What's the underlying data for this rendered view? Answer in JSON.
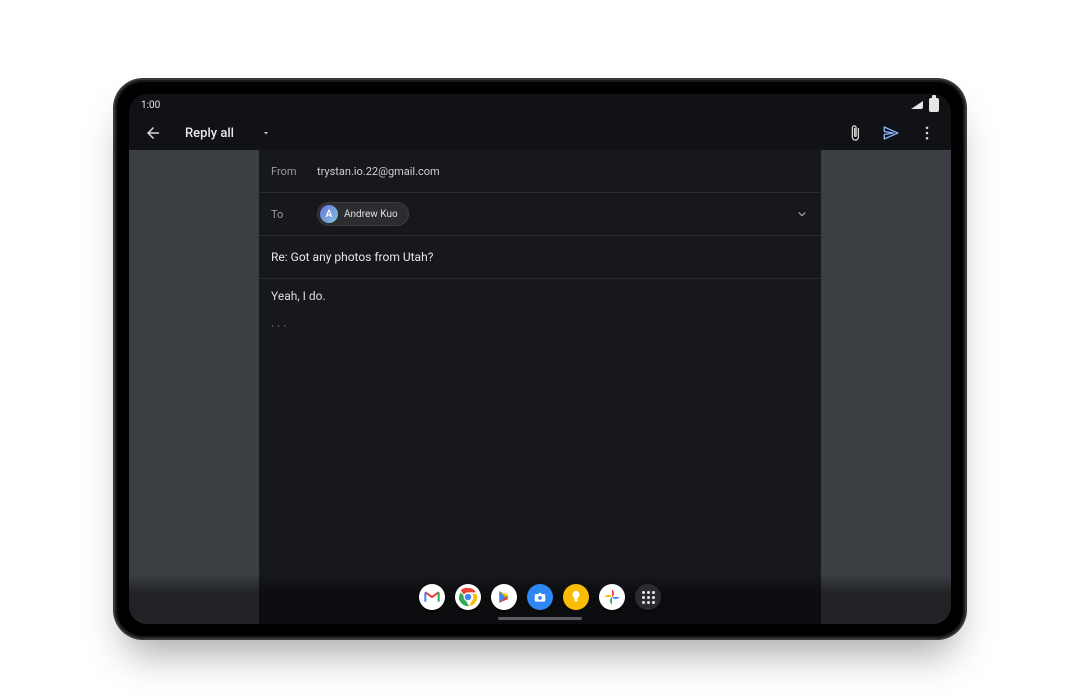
{
  "status": {
    "time": "1:00"
  },
  "appbar": {
    "title": "Reply all"
  },
  "compose": {
    "from_label": "From",
    "from_value": "trystan.io.22@gmail.com",
    "to_label": "To",
    "to_chip": {
      "initial": "A",
      "name": "Andrew Kuo"
    },
    "subject": "Re: Got any photos from Utah?",
    "body": "Yeah, I do.",
    "quoted_toggle": "···"
  },
  "taskbar": {
    "items": [
      {
        "name": "gmail-app-icon"
      },
      {
        "name": "chrome-app-icon"
      },
      {
        "name": "play-store-app-icon"
      },
      {
        "name": "camera-app-icon"
      },
      {
        "name": "keep-app-icon"
      },
      {
        "name": "photos-app-icon"
      },
      {
        "name": "all-apps-icon"
      }
    ]
  }
}
